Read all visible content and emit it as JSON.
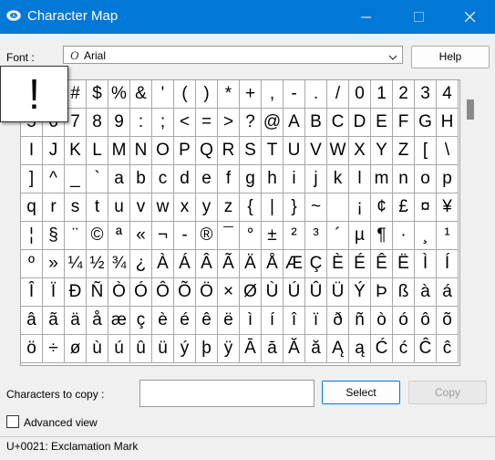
{
  "window": {
    "title": "Character Map",
    "icon": "charmap-app-icon"
  },
  "font": {
    "label": "Font :",
    "selected": "Arial",
    "type_icon": "opentype-font-icon"
  },
  "help_label": "Help",
  "grid": {
    "rows": [
      [
        "",
        "!",
        "\"",
        "#",
        "$",
        "%",
        "&",
        "'",
        "(",
        ")",
        "*",
        "+",
        ",",
        "-",
        ".",
        "/",
        "0",
        "1",
        "2",
        "3",
        "4"
      ],
      [
        "5",
        "6",
        "7",
        "8",
        "9",
        ":",
        ";",
        "<",
        "=",
        ">",
        "?",
        "@",
        "A",
        "B",
        "C",
        "D",
        "E",
        "F",
        "G",
        "H"
      ],
      [
        "I",
        "J",
        "K",
        "L",
        "M",
        "N",
        "O",
        "P",
        "Q",
        "R",
        "S",
        "T",
        "U",
        "V",
        "W",
        "X",
        "Y",
        "Z",
        "[",
        "\\"
      ],
      [
        "]",
        "^",
        "_",
        "`",
        "a",
        "b",
        "c",
        "d",
        "e",
        "f",
        "g",
        "h",
        "i",
        "j",
        "k",
        "l",
        "m",
        "n",
        "o",
        "p"
      ],
      [
        "q",
        "r",
        "s",
        "t",
        "u",
        "v",
        "w",
        "x",
        "y",
        "z",
        "{",
        "|",
        "}",
        "~",
        "",
        "¡",
        "¢",
        "£",
        "¤",
        "¥"
      ],
      [
        "¦",
        "§",
        "¨",
        "©",
        "ª",
        "«",
        "¬",
        "-",
        "®",
        "¯",
        "°",
        "±",
        "²",
        "³",
        "´",
        "µ",
        "¶",
        "·",
        "¸",
        "¹"
      ],
      [
        "º",
        "»",
        "¼",
        "½",
        "¾",
        "¿",
        "À",
        "Á",
        "Â",
        "Ã",
        "Ä",
        "Å",
        "Æ",
        "Ç",
        "È",
        "É",
        "Ê",
        "Ë",
        "Ì",
        "Í"
      ],
      [
        "Î",
        "Ï",
        "Ð",
        "Ñ",
        "Ò",
        "Ó",
        "Ô",
        "Õ",
        "Ö",
        "×",
        "Ø",
        "Ù",
        "Ú",
        "Û",
        "Ü",
        "Ý",
        "Þ",
        "ß",
        "à",
        "á"
      ],
      [
        "â",
        "ã",
        "ä",
        "å",
        "æ",
        "ç",
        "è",
        "é",
        "ê",
        "ë",
        "ì",
        "í",
        "î",
        "ï",
        "ð",
        "ñ",
        "ò",
        "ó",
        "ô",
        "õ"
      ],
      [
        "ö",
        "÷",
        "ø",
        "ù",
        "ú",
        "û",
        "ü",
        "ý",
        "þ",
        "ÿ",
        "Ā",
        "ā",
        "Ă",
        "ă",
        "Ą",
        "ą",
        "Ć",
        "ć",
        "Ĉ",
        "ĉ"
      ]
    ],
    "magnified_char": "!"
  },
  "copy": {
    "label": "Characters to copy :",
    "value": "",
    "select_label": "Select",
    "copy_label": "Copy"
  },
  "advanced": {
    "label": "Advanced view",
    "checked": false
  },
  "status": "U+0021: Exclamation Mark",
  "colors": {
    "titlebar": "#0078d7",
    "accent": "#0078d7"
  }
}
